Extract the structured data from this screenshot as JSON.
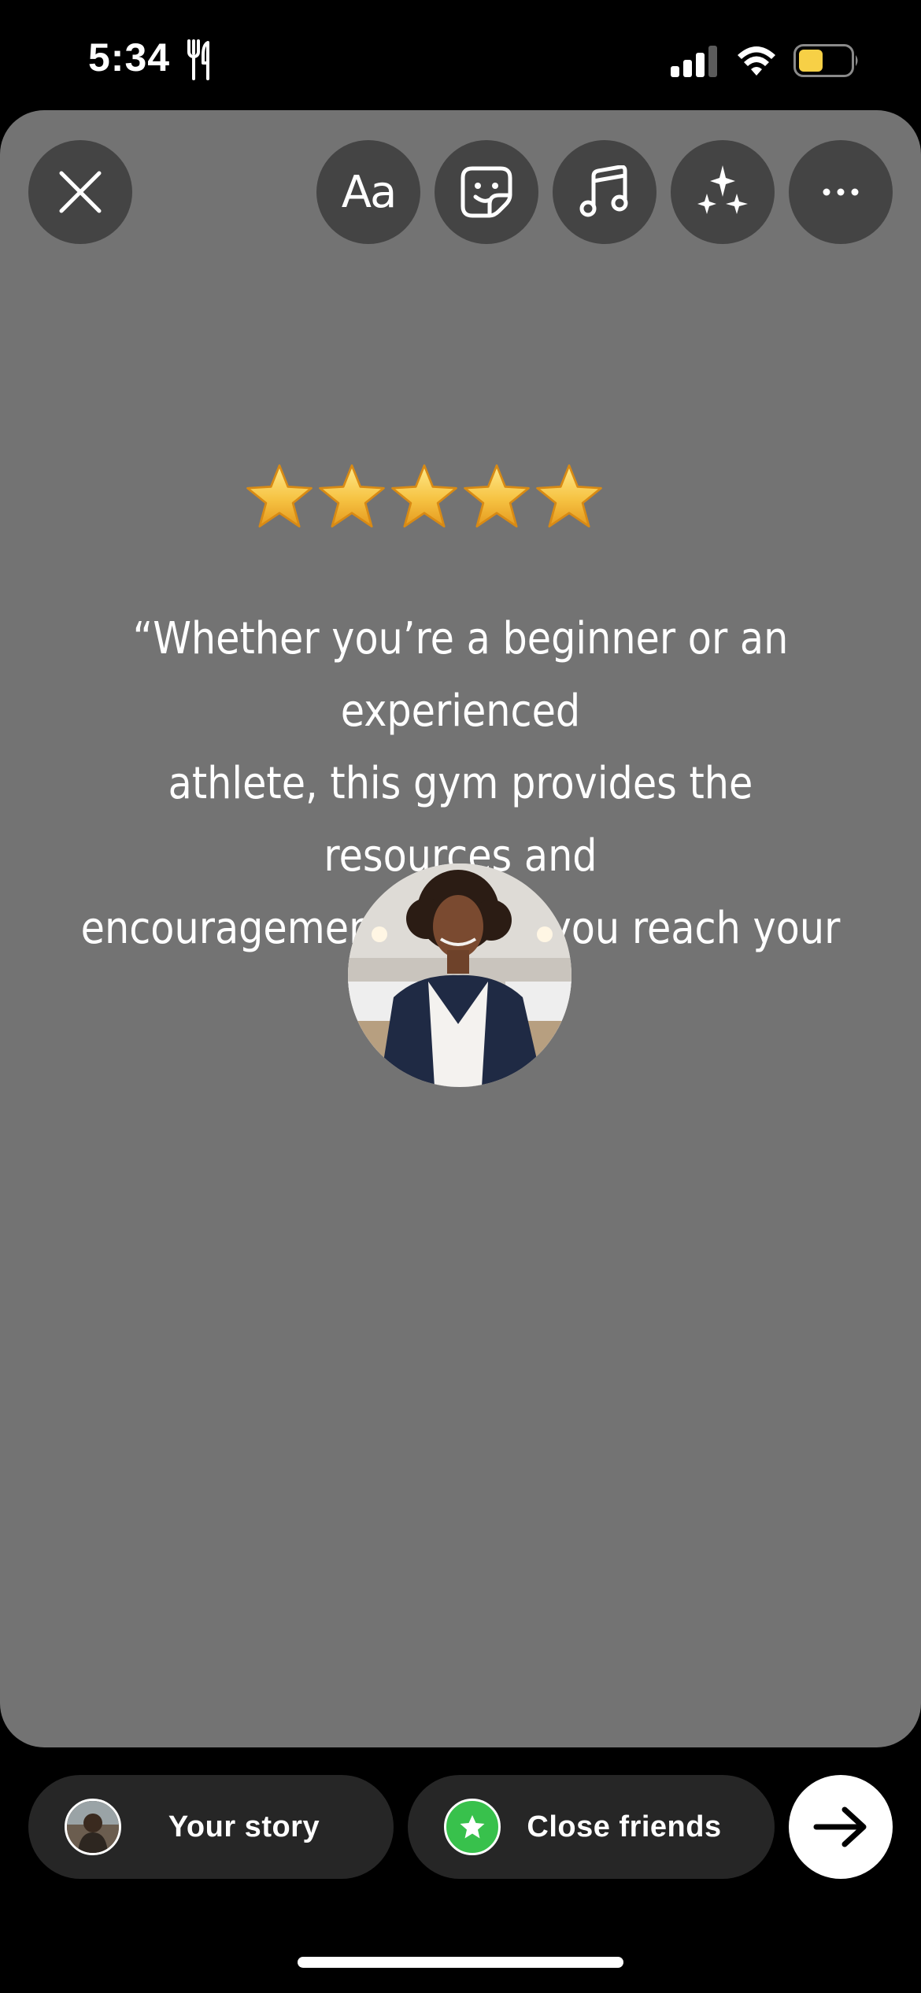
{
  "status_bar": {
    "time": "5:34",
    "activity_icon": "fork-knife-icon",
    "signal_icon": "cellular-signal-icon",
    "wifi_icon": "wifi-icon",
    "battery_icon": "battery-icon",
    "battery_color": "#f7d046"
  },
  "toolbar": {
    "close_icon": "close-icon",
    "text_button_label": "Aa",
    "sticker_icon": "sticker-icon",
    "music_icon": "music-note-icon",
    "effects_icon": "sparkles-icon",
    "more_icon": "more-icon"
  },
  "story": {
    "background_color": "#737373",
    "rating": {
      "value": 5,
      "max": 5,
      "star_color": "#f6c343"
    },
    "quote_lines": [
      "“Whether you’re a beginner or an experienced",
      "athlete, this gym provides the resources and",
      "encouragement to help you reach your goals.”"
    ],
    "photo_description": "circular-portrait"
  },
  "bottom_bar": {
    "your_story_label": "Your story",
    "close_friends_label": "Close friends",
    "close_friends_color": "#38c14c",
    "next_icon": "arrow-right-icon"
  }
}
